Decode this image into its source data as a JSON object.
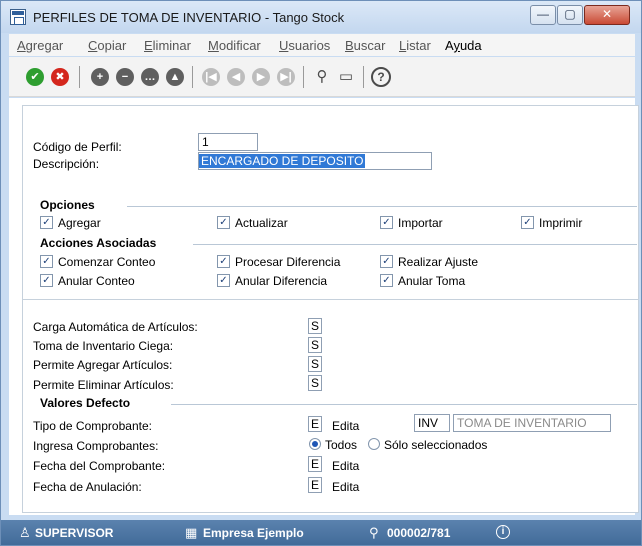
{
  "window": {
    "title": "PERFILES DE TOMA DE INVENTARIO - Tango Stock",
    "controls": {
      "minimize": "—",
      "maximize": "▢",
      "close": "✕"
    }
  },
  "menu": [
    {
      "label": "Agregar",
      "mnemonic": "A",
      "rest": "gregar"
    },
    {
      "label": "Copiar",
      "mnemonic": "C",
      "rest": "opiar"
    },
    {
      "label": "Eliminar",
      "mnemonic": "E",
      "rest": "liminar"
    },
    {
      "label": "Modificar",
      "mnemonic": "M",
      "rest": "odificar"
    },
    {
      "label": "Usuarios",
      "mnemonic": "U",
      "rest": "suarios"
    },
    {
      "label": "Buscar",
      "mnemonic": "B",
      "rest": "uscar"
    },
    {
      "label": "Listar",
      "mnemonic": "L",
      "rest": "istar"
    },
    {
      "label": "Ayuda",
      "mnemonic": "y",
      "pre": "A",
      "rest": "uda"
    }
  ],
  "toolbar": {
    "icons": [
      "accept-icon",
      "cancel-icon",
      "add-icon",
      "remove-icon",
      "more-icon",
      "up-icon",
      "first-icon",
      "previous-icon",
      "next-icon",
      "last-icon",
      "binoculars-icon",
      "monitor-icon",
      "help-icon"
    ],
    "glyphs": {
      "ok": "✔",
      "cancel": "✖",
      "add": "+",
      "remove": "−",
      "more": "…",
      "up": "▲",
      "first": "|◀",
      "prev": "◀",
      "next": "▶",
      "last": "▶|",
      "find": "⚲",
      "screen": "▭",
      "help": "?"
    }
  },
  "form": {
    "codigo_label": "Código de Perfil:",
    "codigo_value": "1",
    "descripcion_label": "Descripción:",
    "descripcion_value": "ENCARGADO DE DEPOSITO"
  },
  "opciones": {
    "title": "Opciones",
    "items": [
      {
        "label": "Agregar",
        "checked": true
      },
      {
        "label": "Actualizar",
        "checked": true
      },
      {
        "label": "Importar",
        "checked": true
      },
      {
        "label": "Imprimir",
        "checked": true
      }
    ]
  },
  "acciones": {
    "title": "Acciones Asociadas",
    "items": [
      {
        "label": "Comenzar Conteo",
        "checked": true
      },
      {
        "label": "Procesar Diferencia",
        "checked": true
      },
      {
        "label": "Realizar Ajuste",
        "checked": true
      },
      {
        "label": "Anular Conteo",
        "checked": true
      },
      {
        "label": "Anular Diferencia",
        "checked": true
      },
      {
        "label": "Anular Toma",
        "checked": true
      }
    ]
  },
  "flags": [
    {
      "label": "Carga Automática de Artículos:",
      "value": "S"
    },
    {
      "label": "Toma de Inventario Ciega:",
      "value": "S"
    },
    {
      "label": "Permite Agregar Artículos:",
      "value": "S"
    },
    {
      "label": "Permite Eliminar Artículos:",
      "value": "S"
    }
  ],
  "valores": {
    "title": "Valores Defecto",
    "tipo_label": "Tipo de Comprobante:",
    "tipo_value": "E",
    "tipo_desc": "Edita",
    "tipo_code": "INV",
    "tipo_name": "TOMA DE INVENTARIO",
    "ingresa_label": "Ingresa Comprobantes:",
    "radio_todos": "Todos",
    "radio_sel": "Sólo seleccionados",
    "fecha_comp_label": "Fecha del Comprobante:",
    "fecha_comp_value": "E",
    "fecha_comp_desc": "Edita",
    "fecha_anul_label": "Fecha de Anulación:",
    "fecha_anul_value": "E",
    "fecha_anul_desc": "Edita"
  },
  "status": {
    "user": "SUPERVISOR",
    "company": "Empresa Ejemplo",
    "code": "000002/781",
    "user_icon": "user-icon",
    "company_icon": "building-icon",
    "code_icon": "link-icon",
    "info_icon": "info-icon",
    "bar_color": "#4a73a1"
  }
}
